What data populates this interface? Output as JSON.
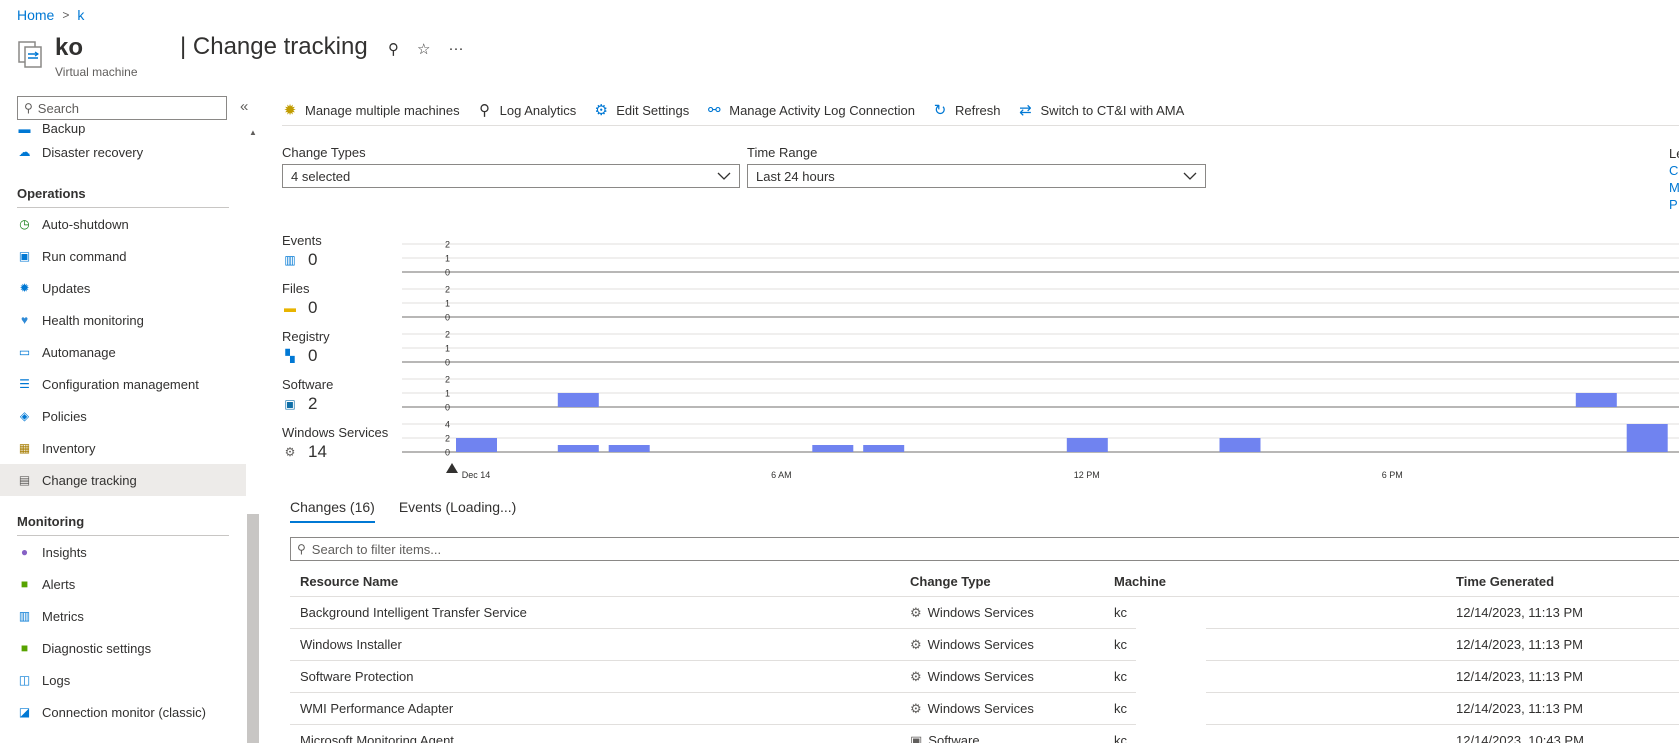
{
  "breadcrumb": {
    "home": "Home",
    "separator": ">",
    "current": "k"
  },
  "resource": {
    "name": "ko",
    "type": "Virtual machine"
  },
  "page": {
    "title": "| Change tracking",
    "pin": "⚲",
    "star": "☆",
    "more": "···"
  },
  "sidebar": {
    "search_placeholder": "Search",
    "collapse": "«",
    "partial_item": "Backup",
    "items_top": [
      {
        "label": "Disaster recovery",
        "icon": "disaster-recovery-icon",
        "glyph": "☁",
        "color": "#0078d4"
      }
    ],
    "sections": [
      {
        "title": "Operations",
        "items": [
          {
            "label": "Auto-shutdown",
            "icon": "clock-icon",
            "glyph": "◷",
            "color": "#107c10"
          },
          {
            "label": "Run command",
            "icon": "run-command-icon",
            "glyph": "▣",
            "color": "#0078d4"
          },
          {
            "label": "Updates",
            "icon": "gear-icon",
            "glyph": "✹",
            "color": "#0078d4"
          },
          {
            "label": "Health monitoring",
            "icon": "heart-pulse-icon",
            "glyph": "♥",
            "color": "#2f8ad6"
          },
          {
            "label": "Automanage",
            "icon": "monitor-icon",
            "glyph": "▭",
            "color": "#0078d4"
          },
          {
            "label": "Configuration management",
            "icon": "list-icon",
            "glyph": "☰",
            "color": "#0078d4"
          },
          {
            "label": "Policies",
            "icon": "policy-icon",
            "glyph": "◈",
            "color": "#0078d4"
          },
          {
            "label": "Inventory",
            "icon": "inventory-icon",
            "glyph": "▦",
            "color": "#a67c00"
          },
          {
            "label": "Change tracking",
            "icon": "change-tracking-icon",
            "glyph": "▤",
            "color": "#605e5c",
            "active": true
          }
        ]
      },
      {
        "title": "Monitoring",
        "items": [
          {
            "label": "Insights",
            "icon": "bulb-icon",
            "glyph": "●",
            "color": "#8661c5"
          },
          {
            "label": "Alerts",
            "icon": "alert-icon",
            "glyph": "■",
            "color": "#57a300"
          },
          {
            "label": "Metrics",
            "icon": "metrics-icon",
            "glyph": "▥",
            "color": "#0078d4"
          },
          {
            "label": "Diagnostic settings",
            "icon": "diagnostic-icon",
            "glyph": "■",
            "color": "#57a300"
          },
          {
            "label": "Logs",
            "icon": "logs-icon",
            "glyph": "◫",
            "color": "#0078d4"
          },
          {
            "label": "Connection monitor (classic)",
            "icon": "connection-monitor-icon",
            "glyph": "◪",
            "color": "#0078d4"
          }
        ]
      }
    ]
  },
  "toolbar": {
    "items": [
      {
        "label": "Manage multiple machines",
        "icon": "manage-machines-icon",
        "glyph": "✹",
        "color": "#c19c00"
      },
      {
        "label": "Log Analytics",
        "icon": "search-icon",
        "glyph": "⚲",
        "color": "#323130"
      },
      {
        "label": "Edit Settings",
        "icon": "settings-icon",
        "glyph": "⚙",
        "color": "#0078d4"
      },
      {
        "label": "Manage Activity Log Connection",
        "icon": "link-icon",
        "glyph": "⚯",
        "color": "#0078d4"
      },
      {
        "label": "Refresh",
        "icon": "refresh-icon",
        "glyph": "↻",
        "color": "#0078d4"
      },
      {
        "label": "Switch to CT&I with AMA",
        "icon": "switch-icon",
        "glyph": "⇄",
        "color": "#0078d4"
      }
    ]
  },
  "filters": {
    "change_types_label": "Change Types",
    "change_types_value": "4 selected",
    "time_range_label": "Time Range",
    "time_range_value": "Last 24 hours",
    "legend_letters": [
      "Le",
      "C",
      "M",
      "P"
    ]
  },
  "summary": [
    {
      "name": "Events",
      "count": "0",
      "icon": "events-icon",
      "glyph": "▥",
      "color": "#0078d4"
    },
    {
      "name": "Files",
      "count": "0",
      "icon": "folder-icon",
      "glyph": "▬",
      "color": "#e8b400"
    },
    {
      "name": "Registry",
      "count": "0",
      "icon": "registry-icon",
      "glyph": "▚",
      "color": "#0078d4"
    },
    {
      "name": "Software",
      "count": "2",
      "icon": "software-icon",
      "glyph": "▣",
      "color": "#0f6fa8"
    },
    {
      "name": "Windows Services",
      "count": "14",
      "icon": "services-icon",
      "glyph": "⚙",
      "color": "#605e5c"
    }
  ],
  "chart_data": {
    "type": "bar",
    "bar_color": "#7083f0",
    "x_tick_labels": [
      "Dec 14",
      "6 AM",
      "12 PM",
      "6 PM"
    ],
    "panels": [
      {
        "name": "Events",
        "y_ticks": [
          "2",
          "1",
          "0"
        ],
        "ymax": 2,
        "bars": []
      },
      {
        "name": "Files",
        "y_ticks": [
          "2",
          "1",
          "0"
        ],
        "ymax": 2,
        "bars": []
      },
      {
        "name": "Registry",
        "y_ticks": [
          "2",
          "1",
          "0"
        ],
        "ymax": 2,
        "bars": []
      },
      {
        "name": "Software",
        "y_ticks": [
          "2",
          "1",
          "0"
        ],
        "ymax": 2,
        "bars": [
          {
            "hour": 3,
            "value": 1
          },
          {
            "hour": 23,
            "value": 1
          }
        ]
      },
      {
        "name": "Windows Services",
        "y_ticks": [
          "4",
          "2",
          "0"
        ],
        "ymax": 4,
        "bars": [
          {
            "hour": 1,
            "value": 2
          },
          {
            "hour": 3,
            "value": 1
          },
          {
            "hour": 4,
            "value": 1
          },
          {
            "hour": 8,
            "value": 1
          },
          {
            "hour": 9,
            "value": 1
          },
          {
            "hour": 13,
            "value": 2
          },
          {
            "hour": 16,
            "value": 2
          },
          {
            "hour": 24,
            "value": 4
          }
        ]
      }
    ]
  },
  "tabs": [
    {
      "label": "Changes (16)",
      "active": true
    },
    {
      "label": "Events (Loading...)",
      "active": false
    }
  ],
  "table": {
    "filter_placeholder": "Search to filter items...",
    "headers": [
      "Resource Name",
      "Change Type",
      "Machine",
      "Time Generated"
    ],
    "rows": [
      {
        "name": "Background Intelligent Transfer Service",
        "type": "Windows Services",
        "type_glyph": "⚙",
        "machine": "kc",
        "time": "12/14/2023, 11:13 PM"
      },
      {
        "name": "Windows Installer",
        "type": "Windows Services",
        "type_glyph": "⚙",
        "machine": "kc",
        "time": "12/14/2023, 11:13 PM"
      },
      {
        "name": "Software Protection",
        "type": "Windows Services",
        "type_glyph": "⚙",
        "machine": "kc",
        "time": "12/14/2023, 11:13 PM"
      },
      {
        "name": "WMI Performance Adapter",
        "type": "Windows Services",
        "type_glyph": "⚙",
        "machine": "kc",
        "time": "12/14/2023, 11:13 PM"
      },
      {
        "name": "Microsoft Monitoring Agent",
        "type": "Software",
        "type_glyph": "▣",
        "machine": "kc",
        "time": "12/14/2023, 10:43 PM"
      }
    ]
  }
}
